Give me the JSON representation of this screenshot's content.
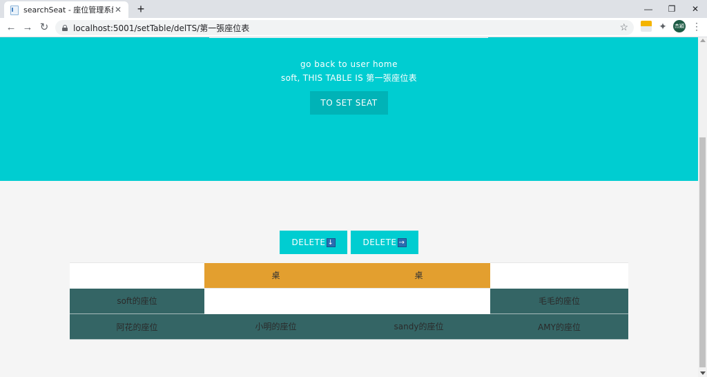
{
  "browser": {
    "tab_title": "searchSeat - 座位管理系統",
    "tab_close": "✕",
    "new_tab": "+",
    "url": "localhost:5001/setTable/delTS/第一張座位表",
    "profile_initials": "杰穎",
    "icons": {
      "back": "←",
      "forward": "→",
      "reload": "↻",
      "star": "☆",
      "puzzle": "✦",
      "menu": "⋮",
      "minimize": "—",
      "restore": "❐",
      "close": "✕"
    }
  },
  "hero": {
    "link_text": "go back to user home",
    "subtitle": "soft, THIS TABLE IS 第一張座位表",
    "set_seat_button": "TO SET SEAT"
  },
  "delete_buttons": [
    {
      "label": "DELETE",
      "arrow": "↓"
    },
    {
      "label": "DELETE",
      "arrow": "→"
    }
  ],
  "seat_table": {
    "rows": [
      [
        {
          "kind": "empty",
          "text": ""
        },
        {
          "kind": "desk",
          "text": "桌"
        },
        {
          "kind": "desk",
          "text": "桌"
        },
        {
          "kind": "empty",
          "text": ""
        }
      ],
      [
        {
          "kind": "seat",
          "text": "soft的座位"
        },
        {
          "kind": "empty",
          "text": ""
        },
        {
          "kind": "empty",
          "text": ""
        },
        {
          "kind": "seat",
          "text": "毛毛的座位"
        }
      ],
      [
        {
          "kind": "seat",
          "text": "阿花的座位"
        },
        {
          "kind": "seat",
          "text": "小明的座位"
        },
        {
          "kind": "seat",
          "text": "sandy的座位"
        },
        {
          "kind": "seat",
          "text": "AMY的座位"
        }
      ]
    ]
  },
  "colors": {
    "hero_bg": "#00cdd1",
    "hero_button_bg": "#00b3b7",
    "desk": "#e39f2f",
    "seat": "#346565",
    "page_bg": "#f5f5f5"
  }
}
